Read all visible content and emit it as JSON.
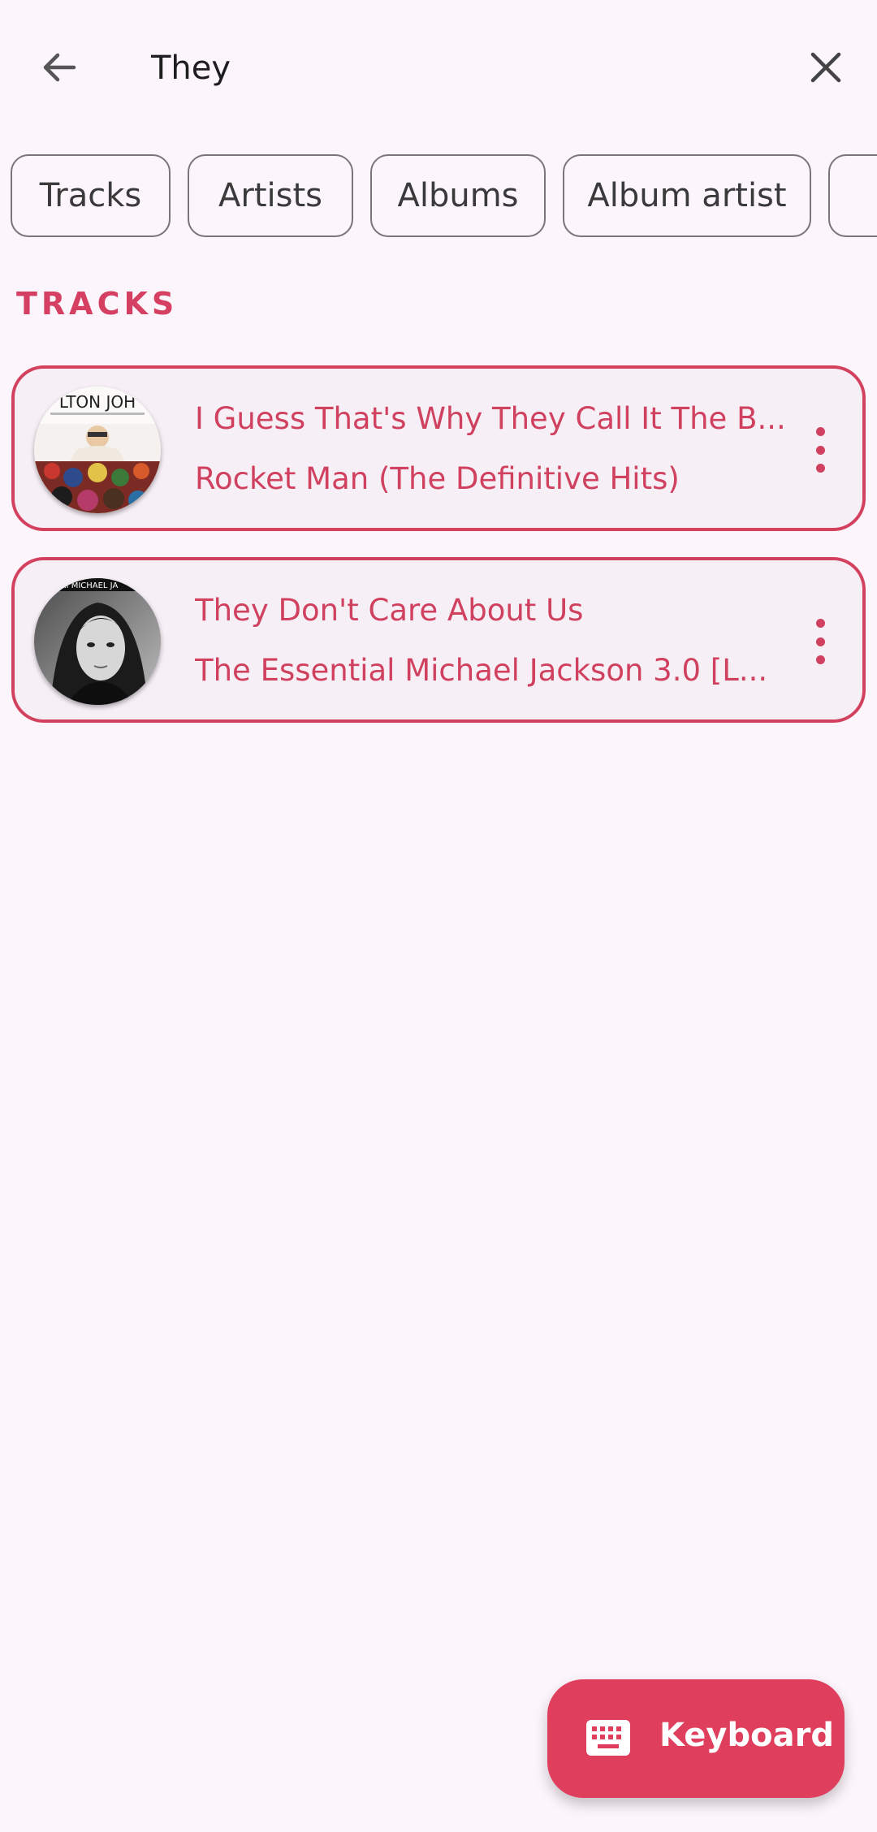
{
  "search": {
    "value": "They",
    "back_icon": "arrow-left-icon",
    "clear_icon": "close-icon"
  },
  "filters": {
    "chips": [
      "Tracks",
      "Artists",
      "Albums",
      "Album artist"
    ]
  },
  "section": {
    "title": "TRACKS"
  },
  "tracks": [
    {
      "title": "I Guess That's Why They Call It The B...",
      "album": "Rocket Man (The Definitive Hits)",
      "cover_text": "LTON JOH"
    },
    {
      "title": "They Don't Care About Us",
      "album": "The Essential Michael Jackson 3.0 [L...",
      "cover_text": "ssential MICHAEL JA"
    }
  ],
  "fab": {
    "label": "Keyboard",
    "icon": "keyboard-icon"
  },
  "colors": {
    "accent": "#d43f62",
    "background": "#fcf5fb",
    "fab": "#df3e5c"
  }
}
